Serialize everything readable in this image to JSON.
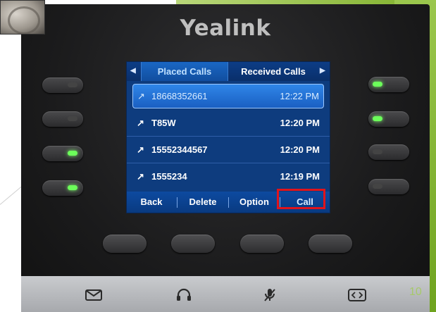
{
  "brand": "Yealink",
  "tabs": {
    "left_arrow": "◀",
    "right_arrow": "▶",
    "placed": "Placed Calls",
    "received": "Received Calls"
  },
  "calls": [
    {
      "arrow": "↗",
      "number": "18668352661",
      "time": "12:22 PM",
      "selected": true
    },
    {
      "arrow": "↗",
      "number": "T85W",
      "time": "12:20 PM"
    },
    {
      "arrow": "↗",
      "number": "15552344567",
      "time": "12:20 PM"
    },
    {
      "arrow": "↗",
      "number": "1555234",
      "time": "12:19 PM"
    }
  ],
  "softkeys": {
    "back": "Back",
    "delete": "Delete",
    "option": "Option",
    "call": "Call"
  },
  "icons": [
    "message-icon",
    "headset-icon",
    "mute-icon",
    "transfer-icon"
  ],
  "leds": {
    "left": [
      "off",
      "off",
      "on",
      "on"
    ],
    "right": [
      "on",
      "on",
      "off",
      "off"
    ]
  },
  "page_number": "10",
  "colors": {
    "screen": "#0e3c7e",
    "selected_row": "#2f86e8",
    "led_on": "#6cff5a",
    "highlight_box": "#e0141c"
  }
}
